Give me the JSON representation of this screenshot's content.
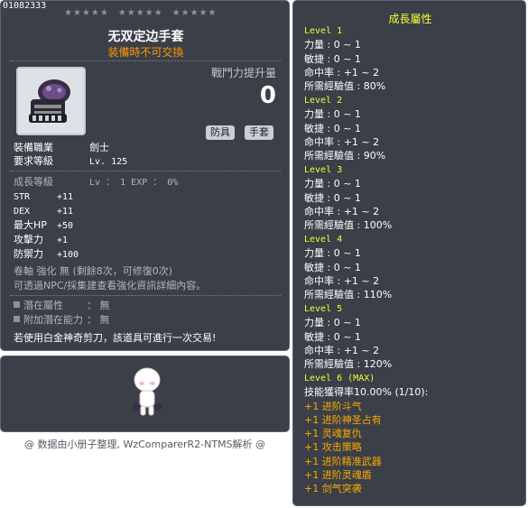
{
  "item": {
    "id": "01082333",
    "name": "无双定边手套",
    "trade_note": "装備時不可交換",
    "power_label": "戰鬥力提升量",
    "power_value": "0",
    "tags": [
      "防具",
      "手套"
    ],
    "job_label": "裝備職業",
    "job_value": "劍士",
    "req_level_label": "要求等級",
    "req_level_value": "Lv. 125",
    "growth_label": "成長等級",
    "growth_value": "Lv ： 1  EXP ： 0%",
    "stats": [
      {
        "name": "STR",
        "value": "+11"
      },
      {
        "name": "DEX",
        "value": "+11"
      },
      {
        "name": "最大HP",
        "value": "+50"
      },
      {
        "name": "攻擊力",
        "value": "+1"
      },
      {
        "name": "防禦力",
        "value": "+100"
      }
    ],
    "enhance_line1": "卷軸 強化 無 (剩餘8次，可修復0次)",
    "enhance_line2": "可透過NPC/採集建查看強化資訊詳細內容。",
    "potential_label": "潛在屬性",
    "potential_value": "： 無",
    "additional_label": "附加潛在能力",
    "additional_value": "： 無",
    "trade_hint": "若使用白金神奇剪刀，該道具可進行一次交易!"
  },
  "credit": "@ 数据由小册子整理, WzComparerR2-NTMS解析 @",
  "growth_panel": {
    "title": "成長屬性",
    "levels": [
      {
        "title": "Level 1",
        "lines": [
          "力量 : 0 ~ 1",
          "敏捷 : 0 ~ 1",
          "命中率 : +1 ~ 2",
          "所需經驗值 : 80%"
        ]
      },
      {
        "title": "Level 2",
        "lines": [
          "力量 : 0 ~ 1",
          "敏捷 : 0 ~ 1",
          "命中率 : +1 ~ 2",
          "所需經驗值 : 90%"
        ]
      },
      {
        "title": "Level 3",
        "lines": [
          "力量 : 0 ~ 1",
          "敏捷 : 0 ~ 1",
          "命中率 : +1 ~ 2",
          "所需經驗值 : 100%"
        ]
      },
      {
        "title": "Level 4",
        "lines": [
          "力量 : 0 ~ 1",
          "敏捷 : 0 ~ 1",
          "命中率 : +1 ~ 2",
          "所需經驗值 : 110%"
        ]
      },
      {
        "title": "Level 5",
        "lines": [
          "力量 : 0 ~ 1",
          "敏捷 : 0 ~ 1",
          "命中率 : +1 ~ 2",
          "所需經驗值 : 120%"
        ]
      }
    ],
    "level6_title": "Level 6 (MAX)",
    "level6_skill_rate": "技能獲得率10.00% (1/10):",
    "level6_skills": [
      "+1 进阶斗气",
      "+1 进阶神圣占有",
      "+1 灵魂复仇",
      "+1 攻击策略",
      "+1 进阶精准武器",
      "+1 进阶灵魂盾",
      "+1 剑气突袭"
    ]
  }
}
